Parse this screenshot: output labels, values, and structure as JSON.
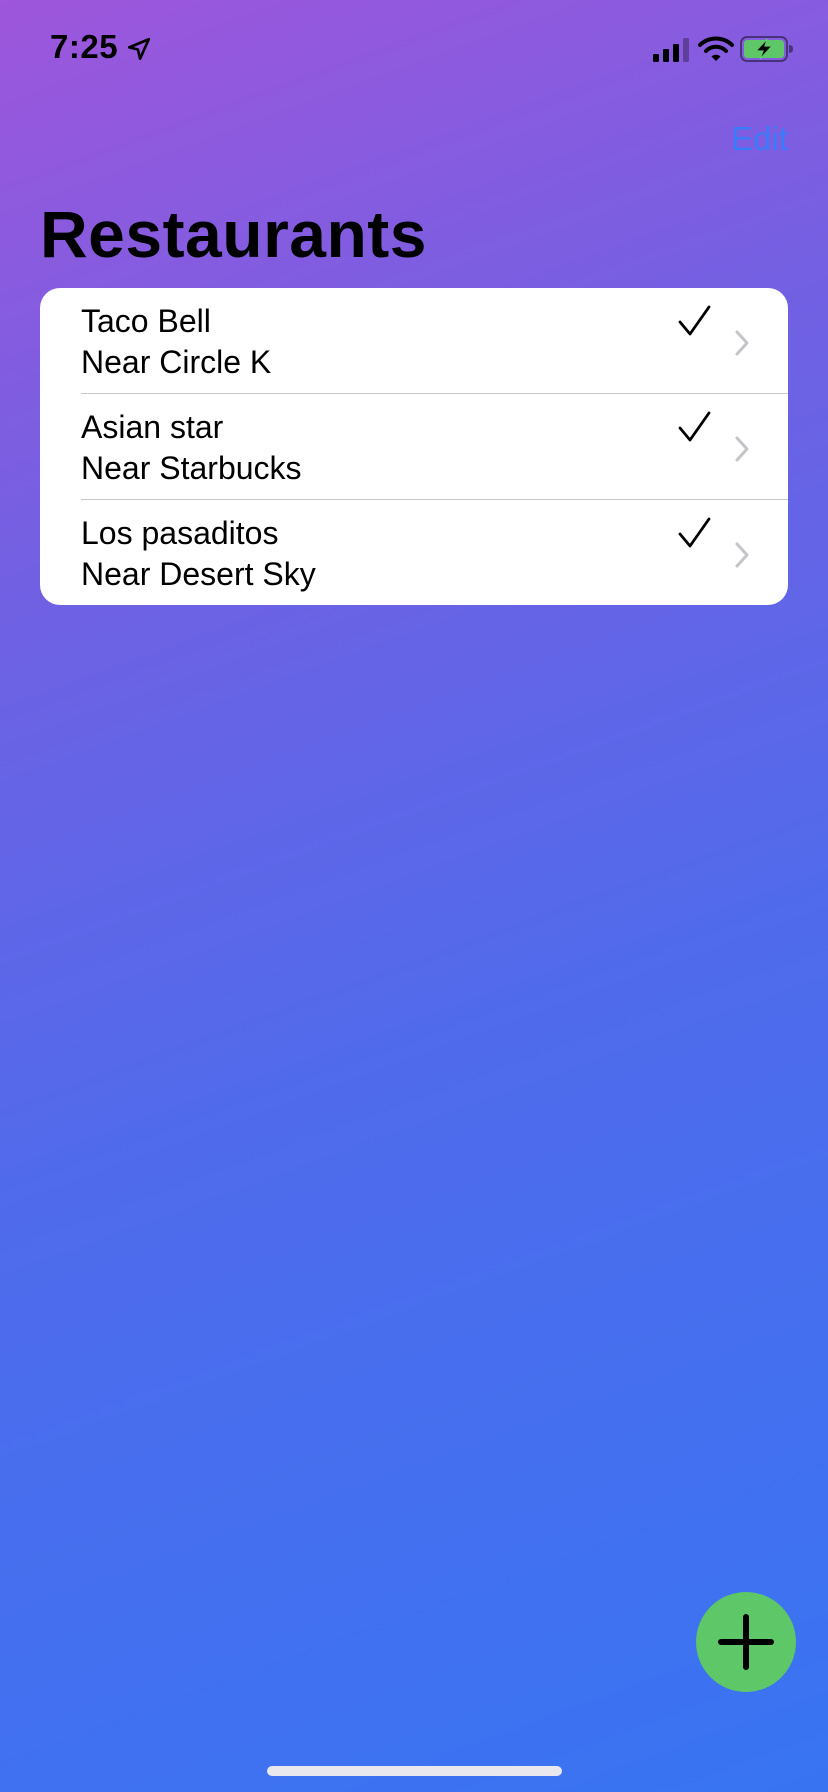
{
  "status_bar": {
    "time": "7:25",
    "icons": [
      "location-arrow-icon",
      "cellular-signal-icon",
      "wifi-icon",
      "battery-charging-icon"
    ],
    "battery_color": "#5ec767"
  },
  "nav": {
    "edit_label": "Edit",
    "title": "Restaurants",
    "accent_color": "#3a7bfa"
  },
  "restaurants": [
    {
      "name": "Taco Bell",
      "near": "Near Circle K",
      "checked": true
    },
    {
      "name": "Asian star",
      "near": "Near Starbucks",
      "checked": true
    },
    {
      "name": "Los pasaditos",
      "near": "Near Desert Sky",
      "checked": true
    }
  ],
  "add_button": {
    "icon": "plus-icon",
    "color": "#5ec767"
  }
}
